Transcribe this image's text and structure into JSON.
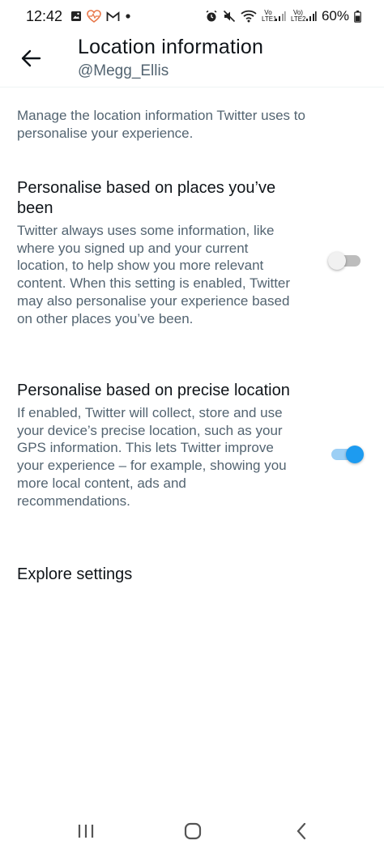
{
  "status_bar": {
    "time": "12:42",
    "left_icons": [
      "image-icon",
      "heart-rate-icon",
      "gmail-icon",
      "dot-icon"
    ],
    "right_icons": [
      "alarm-icon",
      "mute-icon",
      "wifi-icon",
      "lte1-signal-icon",
      "lte2-signal-icon"
    ],
    "lte1_label": "Vo LTE1",
    "lte2_label": "Vo) LTE2",
    "battery": "60%"
  },
  "header": {
    "title": "Location information",
    "subtitle": "@Megg_Ellis"
  },
  "intro": "Manage the location information Twitter uses to personalise your experience.",
  "settings": [
    {
      "title": "Personalise based on places you’ve been",
      "description": "Twitter always uses some information, like where you signed up and your current location, to help show you more relevant content. When this setting is enabled, Twitter may also personalise your experience based on other places you’ve been.",
      "enabled": false
    },
    {
      "title": "Personalise based on precise location",
      "description": "If enabled, Twitter will collect, store and use your device’s precise location, such as your GPS information. This lets Twitter improve your experience – for example, showing you more local content, ads and recommendations.",
      "enabled": true
    }
  ],
  "explore": "Explore settings",
  "colors": {
    "accent": "#1d9bf0",
    "text_primary": "#0f1419",
    "text_secondary": "#536471"
  },
  "nav": [
    "recents-icon",
    "home-icon",
    "back-icon"
  ]
}
